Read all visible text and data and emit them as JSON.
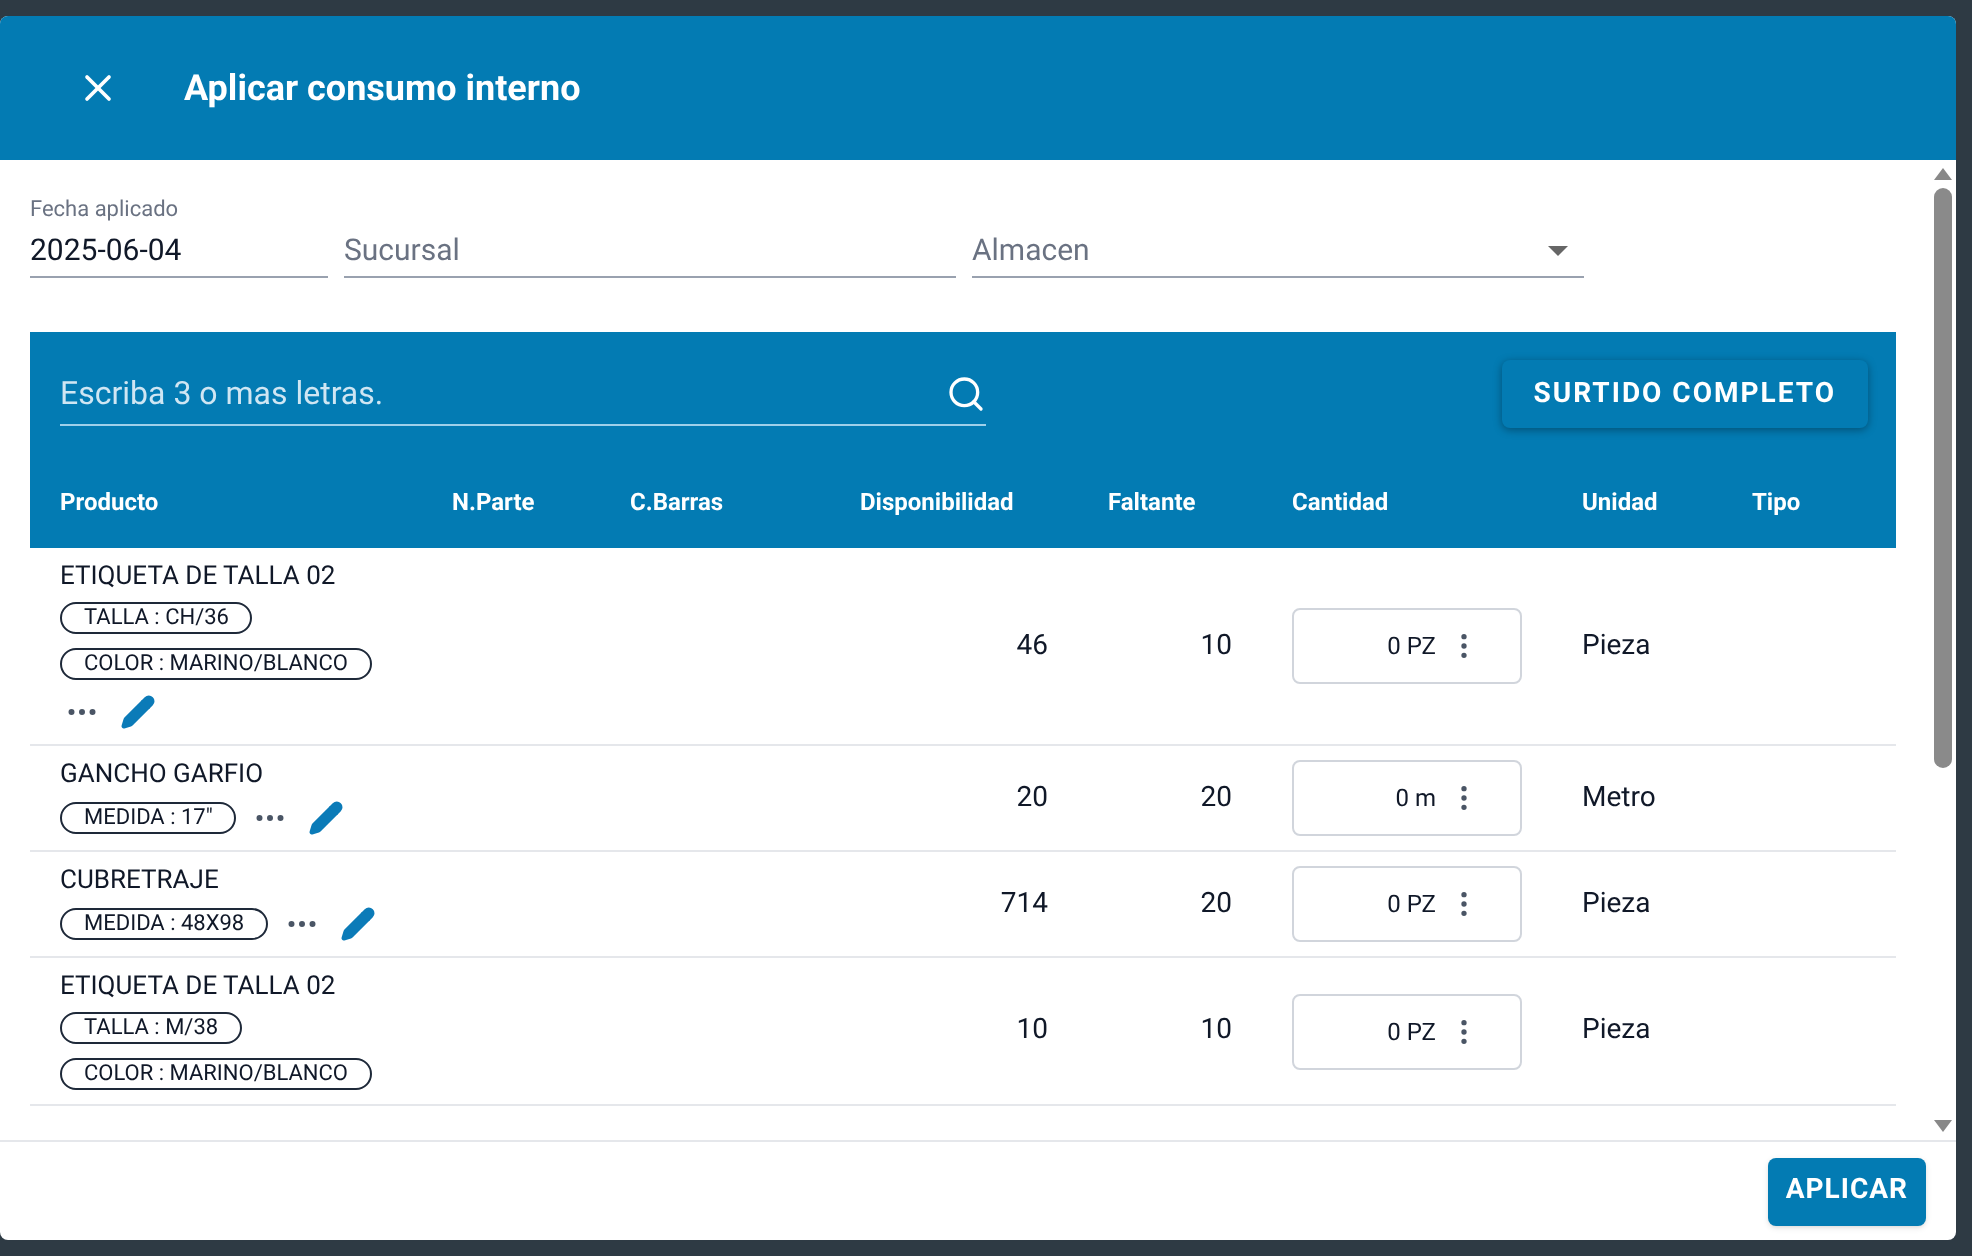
{
  "dialog": {
    "title": "Aplicar consumo interno"
  },
  "fields": [
    {
      "label": "Fecha aplicado",
      "value": "2025-06-04"
    },
    {
      "placeholder": "Sucursal"
    },
    {
      "placeholder": "Almacen"
    }
  ],
  "search": {
    "placeholder": "Escriba 3 o mas letras."
  },
  "surtido_button": "SURTIDO COMPLETO",
  "table": {
    "columns": [
      "Producto",
      "N.Parte",
      "C.Barras",
      "Disponibilidad",
      "Faltante",
      "Cantidad",
      "Unidad",
      "Tipo"
    ],
    "rows": [
      {
        "product": "ETIQUETA DE TALLA 02",
        "chips": [
          "TALLA : CH/36",
          "COLOR : MARINO/BLANCO"
        ],
        "disponibilidad": "46",
        "faltante": "10",
        "cantidad": "0 PZ",
        "unidad": "Pieza"
      },
      {
        "product": "GANCHO GARFIO",
        "chips": [
          "MEDIDA : 17\""
        ],
        "disponibilidad": "20",
        "faltante": "20",
        "cantidad": "0 m",
        "unidad": "Metro"
      },
      {
        "product": "CUBRETRAJE",
        "chips": [
          "MEDIDA : 48X98"
        ],
        "disponibilidad": "714",
        "faltante": "20",
        "cantidad": "0 PZ",
        "unidad": "Pieza"
      },
      {
        "product": "ETIQUETA DE TALLA 02",
        "chips": [
          "TALLA : M/38",
          "COLOR : MARINO/BLANCO"
        ],
        "disponibilidad": "10",
        "faltante": "10",
        "cantidad": "0 PZ",
        "unidad": "Pieza"
      }
    ]
  },
  "apply_button": "APLICAR"
}
